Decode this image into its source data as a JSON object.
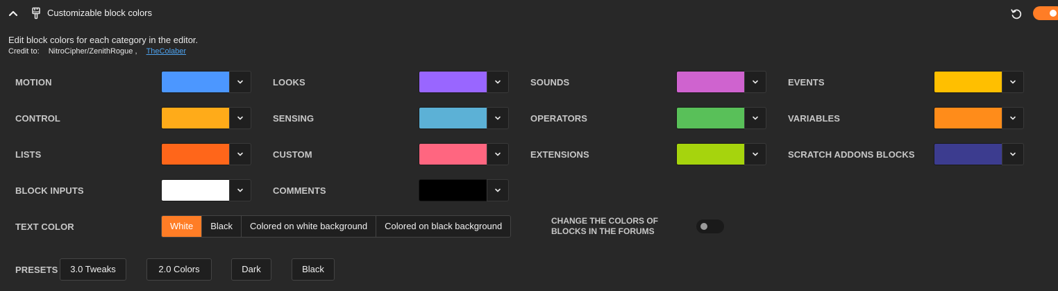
{
  "header": {
    "title": "Customizable block colors",
    "enabled": true
  },
  "description": "Edit block colors for each category in the editor.",
  "credit": {
    "prefix": "Credit to:",
    "author1": "NitroCipher/ZenithRogue",
    "separator": ",",
    "author2": "TheColaber"
  },
  "categories": {
    "motion": {
      "label": "MOTION",
      "color": "#4c97ff"
    },
    "looks": {
      "label": "LOOKS",
      "color": "#9966ff"
    },
    "sounds": {
      "label": "SOUNDS",
      "color": "#cf63cf"
    },
    "events": {
      "label": "EVENTS",
      "color": "#ffbf00"
    },
    "control": {
      "label": "CONTROL",
      "color": "#ffab19"
    },
    "sensing": {
      "label": "SENSING",
      "color": "#5cb1d6"
    },
    "operators": {
      "label": "OPERATORS",
      "color": "#59c059"
    },
    "variables": {
      "label": "VARIABLES",
      "color": "#ff8c1a"
    },
    "lists": {
      "label": "LISTS",
      "color": "#ff661a"
    },
    "custom": {
      "label": "CUSTOM",
      "color": "#ff6680"
    },
    "extensions": {
      "label": "EXTENSIONS",
      "color": "#a6d40d"
    },
    "sa_blocks": {
      "label": "SCRATCH ADDONS BLOCKS",
      "color": "#3c3c8f"
    },
    "block_inputs": {
      "label": "BLOCK INPUTS",
      "color": "#ffffff"
    },
    "comments": {
      "label": "COMMENTS",
      "color": "#000000"
    }
  },
  "text_color": {
    "label": "TEXT COLOR",
    "options": [
      "White",
      "Black",
      "Colored on white background",
      "Colored on black background"
    ],
    "selected": "White"
  },
  "forums": {
    "label": "CHANGE THE COLORS OF BLOCKS IN THE FORUMS",
    "enabled": false
  },
  "presets": {
    "label": "PRESETS",
    "buttons": [
      "3.0 Tweaks",
      "2.0 Colors",
      "Dark",
      "Black"
    ]
  },
  "icons": {
    "collapse": "chevron-up-icon",
    "addon": "brush-icon",
    "reset": "reset-icon",
    "dropdown": "chevron-down-icon"
  },
  "colors": {
    "accent": "#ff7d26",
    "link": "#4ea3ef",
    "background": "#282828"
  }
}
